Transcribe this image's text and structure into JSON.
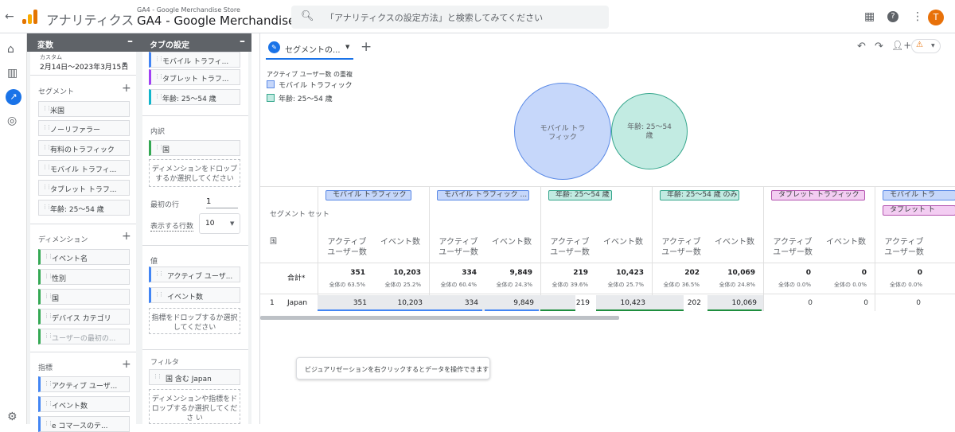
{
  "header": {
    "app_name": "アナリティクス",
    "property_sub": "GA4 - Google Merchandise Store",
    "property_main": "GA4 - Google Merchandise ...",
    "search_placeholder": "「アナリティクスの設定方法」と検索してみてください",
    "avatar": "T"
  },
  "variables": {
    "title": "変数",
    "date_label": "カスタム",
    "date_range": "2月14日～2023年3月15日",
    "segments_label": "セグメント",
    "segments": [
      "米国",
      "ノーリファラー",
      "有料のトラフィック",
      "モバイル トラフィ...",
      "タブレット トラフ...",
      "年齢: 25～54 歳"
    ],
    "dimensions_label": "ディメンション",
    "dimensions": [
      "イベント名",
      "性別",
      "国",
      "デバイス カテゴリ",
      "ユーザーの最初の..."
    ],
    "metrics_label": "指標",
    "metrics": [
      "アクティブ ユーザ...",
      "イベント数",
      "e コマースのテ..."
    ]
  },
  "tab_settings": {
    "title": "タブの設定",
    "segment_chips": [
      "モバイル トラフィ...",
      "タブレット トラフ...",
      "年齢: 25～54 歳"
    ],
    "breakdown_label": "内訳",
    "breakdown_chip": "国",
    "breakdown_drop": "ディメンションをドロップするか選択してください",
    "start_row_label": "最初の行",
    "start_row": "1",
    "rows_label": "表示する行数",
    "rows": "10",
    "values_label": "値",
    "value_chips": [
      "アクティブ ユーザ...",
      "イベント数"
    ],
    "values_drop": "指標をドロップするか選択してください",
    "filter_label": "フィルタ",
    "filter_chip": "国 含む Japan",
    "filter_drop": "ディメンションや指標をドロップするか選択してくださ い"
  },
  "canvas": {
    "tab_label": "セグメントの...",
    "viz_title": "アクティブ ユーザー数 の重複",
    "legend": [
      "モバイル トラフィック",
      "年齢: 25～54 歳"
    ],
    "venn": [
      {
        "label": "モバイル トラフィック",
        "color": "#c6d7fa"
      },
      {
        "label": "年齢: 25～54 歳",
        "color": "#c2ebe2"
      }
    ],
    "segment_set_label": "セグメント セット",
    "country_label": "国",
    "total_label": "合計*",
    "segment_headers": [
      "モバイル トラフィック",
      "モバイル トラフィック ...",
      "年齢: 25～54 歳",
      "年齢: 25～54 歳 のみ",
      "タブレット トラフィック",
      "モバイル トラ",
      "タブレット ト"
    ],
    "metric_headers": {
      "users": "アクティブ ユーザー数",
      "events": "イベント数"
    },
    "totals": [
      [
        "351",
        "全体の 63.5%",
        "10,203",
        "全体の 25.2%"
      ],
      [
        "334",
        "全体の 60.4%",
        "9,849",
        "全体の 24.3%"
      ],
      [
        "219",
        "全体の 39.6%",
        "10,423",
        "全体の 25.7%"
      ],
      [
        "202",
        "全体の 36.5%",
        "10,069",
        "全体の 24.8%"
      ],
      [
        "0",
        "全体の 0.0%",
        "0",
        "全体の 0.0%"
      ],
      [
        "0",
        "全体の 0.0%"
      ]
    ],
    "row": {
      "index": "1",
      "country": "Japan",
      "values": [
        "351",
        "10,203",
        "334",
        "9,849",
        "219",
        "10,423",
        "202",
        "10,069",
        "0",
        "0",
        "0"
      ]
    },
    "tooltip": "ビジュアリゼーションを右クリックするとデータを操作できます"
  }
}
